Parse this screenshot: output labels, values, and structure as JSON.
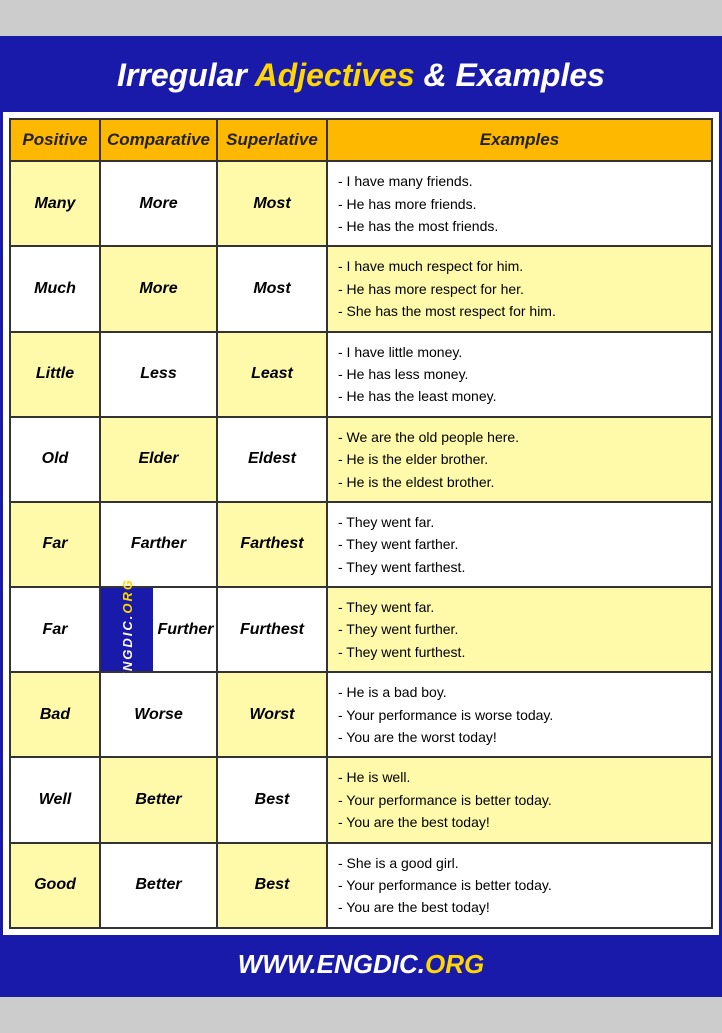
{
  "title": {
    "prefix": "Irregular ",
    "highlight": "Adjectives",
    "suffix": " & Examples"
  },
  "headers": {
    "positive": "Positive",
    "comparative": "Comparative",
    "superlative": "Superlative",
    "examples": "Examples"
  },
  "rows": [
    {
      "positive": "Many",
      "comparative": "More",
      "superlative": "Most",
      "examples": "- I have many friends.\n- He has more friends.\n- He has the most friends."
    },
    {
      "positive": "Much",
      "comparative": "More",
      "superlative": "Most",
      "examples": "- I have much respect for him.\n- He has more respect for her.\n- She has the most respect for him."
    },
    {
      "positive": "Little",
      "comparative": "Less",
      "superlative": "Least",
      "examples": "- I have little money.\n- He has less money.\n- He has the least money."
    },
    {
      "positive": "Old",
      "comparative": "Elder",
      "superlative": "Eldest",
      "examples": "- We are the old people here.\n- He is the elder brother.\n- He is the eldest brother."
    },
    {
      "positive": "Far",
      "comparative": "Farther",
      "superlative": "Farthest",
      "examples": "- They went far.\n- They went farther.\n- They went farthest."
    },
    {
      "positive": "Far",
      "comparative": "Further",
      "superlative": "Furthest",
      "examples": "- They went far.\n- They went further.\n- They went furthest.",
      "watermark": true
    },
    {
      "positive": "Bad",
      "comparative": "Worse",
      "superlative": "Worst",
      "examples": "- He is a bad boy.\n- Your performance is worse today.\n- You are the worst today!"
    },
    {
      "positive": "Well",
      "comparative": "Better",
      "superlative": "Best",
      "examples": "- He is well.\n- Your performance is better today.\n- You are the best today!"
    },
    {
      "positive": "Good",
      "comparative": "Better",
      "superlative": "Best",
      "examples": "- She is a good girl.\n- Your performance is better today.\n- You are the best today!"
    }
  ],
  "footer": {
    "prefix": "WWW.ENGDIC.",
    "suffix": "ORG",
    "full": "WWW.ENGDIC.ORG"
  },
  "watermark": {
    "line1": "ENGDIC.",
    "line2": "ORG"
  }
}
